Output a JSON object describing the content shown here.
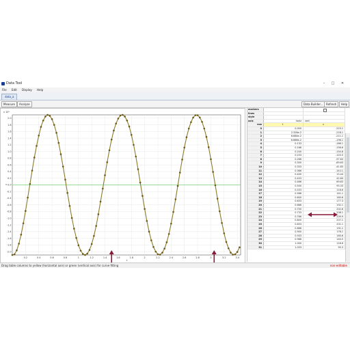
{
  "window": {
    "title": "Data Tool",
    "controls": [
      "–",
      "□",
      "✕"
    ]
  },
  "menu": [
    "File",
    "Edit",
    "Display",
    "Help"
  ],
  "tab": {
    "label": "data_a"
  },
  "toolbar": {
    "measure": "Measure",
    "analyze": "Analyze",
    "data_builder": "Data Builder...",
    "refresh": "Refresh",
    "help": "Help"
  },
  "plot": {
    "exponent_label": "x 10³",
    "y_label": "v",
    "x_label": "t",
    "y_ticks": [
      "2.0",
      "1.8",
      "1.6",
      "1.4",
      "1.2",
      "1.0",
      "0.8",
      "0.6",
      "0.4",
      "0.2",
      "0.0",
      "-0.2",
      "-0.4",
      "-0.6",
      "-0.8",
      "-1.0",
      "-1.2",
      "-1.4",
      "-1.6",
      "-1.8",
      "-2.0"
    ],
    "x_ticks": [
      "0.2",
      "0.4",
      "0.6",
      "0.8",
      "1",
      "1.2",
      "1.4",
      "1.6",
      "1.8",
      "2",
      "2.2",
      "2.4",
      "2.6",
      "2.8",
      "3",
      "3.2",
      "3.4"
    ],
    "colors": {
      "curve": "#8a7a2a",
      "marker": "#6b5a18",
      "zero_line": "#7fd07f",
      "annotation": "#8b1a3a"
    }
  },
  "table": {
    "properties": [
      {
        "name": "markers",
        "col1": "",
        "col2": "check"
      },
      {
        "name": "lines",
        "col1": "",
        "col2": ""
      },
      {
        "name": "style",
        "col1": "",
        "col2": ""
      },
      {
        "name": "axis",
        "col1": "horiz",
        "col2": "vert"
      }
    ],
    "header": {
      "row": "row",
      "col1": "t",
      "col2": "v"
    },
    "rows": [
      [
        "0",
        "0.000",
        "-223.1"
      ],
      [
        "1",
        "2.326e-2",
        "-218.1"
      ],
      [
        "2",
        "6.684e-2",
        "-211.1"
      ],
      [
        "3",
        "6.666e-2",
        "-196.1"
      ],
      [
        "4",
        "0.133",
        "-186.1"
      ],
      [
        "5",
        "0.166",
        "-156.6"
      ],
      [
        "6",
        "0.200",
        "-154.8"
      ],
      [
        "7",
        "0.233",
        "-120.5"
      ],
      [
        "8",
        "0.266",
        "-97.63"
      ],
      [
        "9",
        "0.300",
        "-69.63"
      ],
      [
        "10",
        "0.333",
        "-41.83"
      ],
      [
        "11",
        "0.366",
        "-16.11"
      ],
      [
        "12",
        "0.400",
        "15.44"
      ],
      [
        "13",
        "0.433",
        "42.84"
      ],
      [
        "14",
        "0.466",
        "69.63"
      ],
      [
        "15",
        "0.500",
        "95.33"
      ],
      [
        "16",
        "0.533",
        "118.6"
      ],
      [
        "17",
        "0.566",
        "141.1"
      ],
      [
        "18",
        "0.600",
        "160.6"
      ],
      [
        "19",
        "0.633",
        "177.3"
      ],
      [
        "20",
        "0.666",
        "192.1"
      ],
      [
        "21",
        "0.700",
        "202.6"
      ],
      [
        "22",
        "0.733",
        "208.1"
      ],
      [
        "23",
        "0.766",
        "209.9"
      ],
      [
        "24",
        "0.800",
        "207.1"
      ],
      [
        "25",
        "0.833",
        "201.1"
      ],
      [
        "26",
        "0.866",
        "191.1"
      ],
      [
        "27",
        "0.900",
        "176.1"
      ],
      [
        "28",
        "0.933",
        "160.6"
      ],
      [
        "29",
        "0.966",
        "140.5"
      ],
      [
        "30",
        "1.000",
        "118.6"
      ],
      [
        "31",
        "1.033",
        "95.3"
      ]
    ]
  },
  "status": {
    "message": "Drag table columns to yellow (horizontal axis) or green (vertical axis) for curve fitting",
    "flag": "non-editable"
  },
  "chart_data": {
    "type": "scatter",
    "title": "",
    "xlabel": "t",
    "ylabel": "v",
    "y_multiplier_label": "x 10³",
    "xlim": [
      0.0,
      3.45
    ],
    "ylim": [
      -2.1,
      2.1
    ],
    "grid": true,
    "series": [
      {
        "x": [
          0,
          0.033,
          0.067,
          0.1,
          0.133,
          0.167,
          0.2,
          0.233,
          0.267,
          0.3,
          0.333,
          0.367,
          0.4,
          0.433,
          0.467,
          0.5,
          0.533,
          0.567,
          0.6,
          0.633,
          0.667,
          0.7,
          0.733,
          0.767,
          0.8,
          0.833,
          0.867,
          0.9,
          0.933,
          0.967,
          1.0,
          1.033,
          1.067,
          1.1,
          1.133,
          1.167,
          1.2,
          1.233,
          1.267,
          1.3,
          1.333,
          1.367,
          1.4,
          1.433,
          1.467,
          1.5,
          1.533,
          1.567,
          1.6,
          1.633,
          1.667,
          1.7,
          1.733,
          1.767,
          1.8,
          1.833,
          1.867,
          1.9,
          1.933,
          1.967,
          2.0,
          2.033,
          2.067,
          2.1,
          2.133,
          2.167,
          2.2,
          2.233,
          2.267,
          2.3,
          2.333,
          2.367,
          2.4,
          2.433,
          2.467,
          2.5,
          2.533,
          2.567,
          2.6,
          2.633,
          2.667,
          2.7,
          2.733,
          2.767,
          2.8,
          2.833,
          2.867,
          2.9,
          2.933,
          2.967,
          3.0,
          3.033,
          3.067,
          3.1,
          3.133,
          3.167,
          3.2,
          3.233,
          3.267,
          3.3,
          3.333,
          3.367,
          3.4,
          3.433
        ],
        "y": [
          -2.1,
          -2.08,
          -1.96,
          -1.76,
          -1.49,
          -1.15,
          -0.78,
          -0.38,
          0.03,
          0.43,
          0.82,
          1.17,
          1.48,
          1.74,
          1.93,
          2.05,
          2.1,
          2.07,
          1.97,
          1.8,
          1.56,
          1.26,
          0.92,
          0.55,
          0.16,
          -0.24,
          -0.63,
          -0.99,
          -1.31,
          -1.59,
          -1.81,
          -1.97,
          -2.07,
          -2.1,
          -2.06,
          -1.95,
          -1.77,
          -1.53,
          -1.23,
          -0.88,
          -0.5,
          -0.11,
          0.29,
          0.68,
          1.04,
          1.36,
          1.63,
          1.84,
          1.99,
          2.08,
          2.1,
          2.05,
          1.93,
          1.75,
          1.5,
          1.2,
          0.85,
          0.47,
          0.07,
          -0.33,
          -0.72,
          -1.08,
          -1.4,
          -1.66,
          -1.86,
          -2.0,
          -2.08,
          -2.09,
          -2.03,
          -1.91,
          -1.72,
          -1.47,
          -1.16,
          -0.81,
          -0.43,
          -0.03,
          0.37,
          0.76,
          1.12,
          1.43,
          1.69,
          1.88,
          2.02,
          2.09,
          2.09,
          2.02,
          1.89,
          1.69,
          1.44,
          1.13,
          0.77,
          0.39,
          -0.01,
          -0.41,
          -0.79,
          -1.14,
          -1.45,
          -1.71,
          -1.9,
          -2.03,
          -2.09,
          -2.08,
          -2.01,
          -1.87
        ]
      }
    ],
    "annotations": [
      "arrow at minimum near t=1.5",
      "arrow at minimum near t=3.05",
      "double arrow between table rows 22 and 23"
    ]
  }
}
